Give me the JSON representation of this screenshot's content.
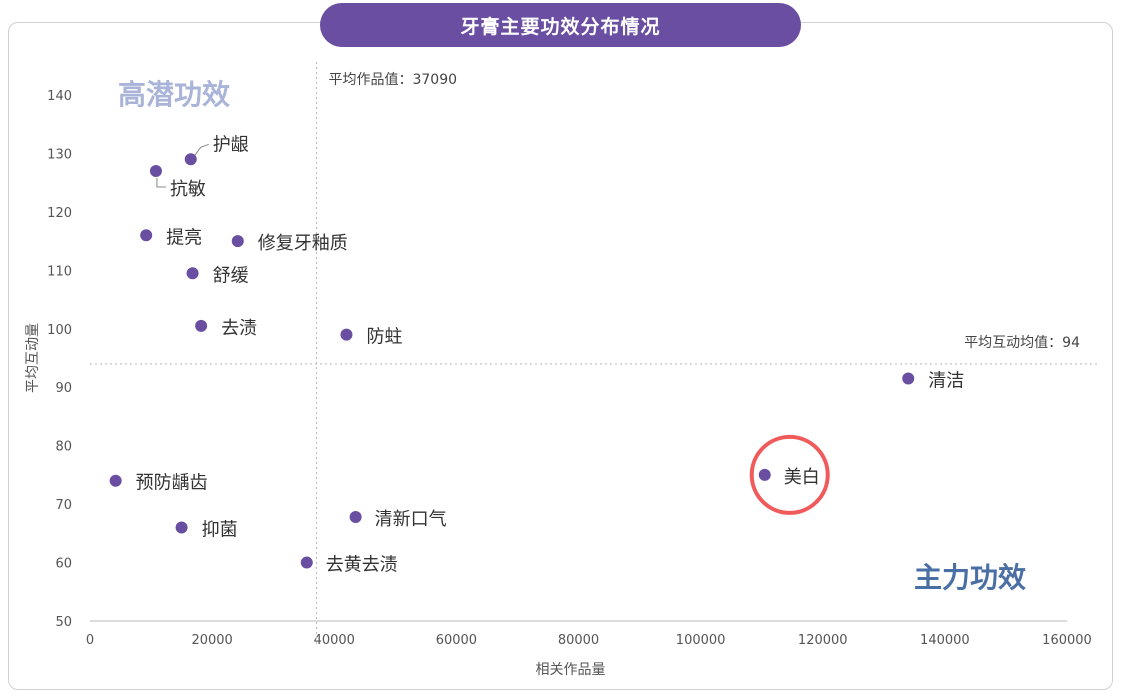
{
  "title": "牙膏主要功效分布情况",
  "colors": {
    "accent": "#6a4ea1",
    "point": "#6a4ea1",
    "highlight": "#f05a5a",
    "quad_high_potential": "#a9b4d8",
    "quad_main": "#4a6fa5"
  },
  "chart_data": {
    "type": "scatter",
    "xlabel": "相关作品量",
    "ylabel": "平均互动量",
    "xlim": [
      0,
      160000
    ],
    "ylim": [
      50,
      140
    ],
    "xticks": [
      0,
      20000,
      40000,
      60000,
      80000,
      100000,
      120000,
      140000,
      160000
    ],
    "yticks": [
      50,
      60,
      70,
      80,
      90,
      100,
      110,
      120,
      130,
      140
    ],
    "grid": false,
    "points": [
      {
        "label": "护龈",
        "x": 16500,
        "y": 129
      },
      {
        "label": "抗敏",
        "x": 10800,
        "y": 127
      },
      {
        "label": "提亮",
        "x": 9200,
        "y": 116
      },
      {
        "label": "修复牙釉质",
        "x": 24200,
        "y": 115
      },
      {
        "label": "舒缓",
        "x": 16800,
        "y": 109.5
      },
      {
        "label": "去渍",
        "x": 18200,
        "y": 100.5
      },
      {
        "label": "防蛀",
        "x": 42000,
        "y": 99
      },
      {
        "label": "清洁",
        "x": 134000,
        "y": 91.5
      },
      {
        "label": "美白",
        "x": 110500,
        "y": 75
      },
      {
        "label": "预防龋齿",
        "x": 4200,
        "y": 74
      },
      {
        "label": "清新口气",
        "x": 43500,
        "y": 67.8
      },
      {
        "label": "抑菌",
        "x": 15000,
        "y": 66
      },
      {
        "label": "去黄去渍",
        "x": 35500,
        "y": 60
      }
    ],
    "highlighted": "美白",
    "reference_lines": {
      "x_mean": 37090,
      "y_mean": 94,
      "x_mean_label": "平均作品值：37090",
      "y_mean_label": "平均互动均值：94"
    },
    "quadrant_labels": {
      "high_potential": "高潜功效",
      "main": "主力功效"
    }
  }
}
